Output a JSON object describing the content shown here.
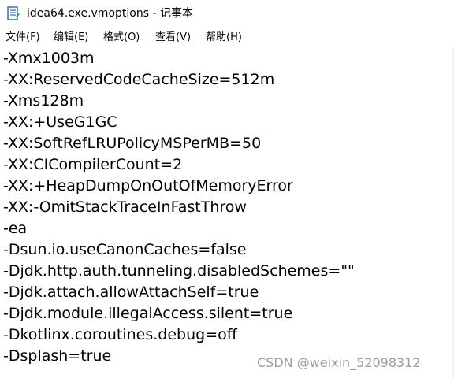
{
  "window": {
    "title": "idea64.exe.vmoptions - 记事本",
    "icon": "notepad-icon"
  },
  "menu": [
    {
      "label": "文件(F)"
    },
    {
      "label": "编辑(E)"
    },
    {
      "label": "格式(O)"
    },
    {
      "label": "查看(V)"
    },
    {
      "label": "帮助(H)"
    }
  ],
  "editor": {
    "lines": [
      "-Xmx1003m",
      "-XX:ReservedCodeCacheSize=512m",
      "-Xms128m",
      "-XX:+UseG1GC",
      "-XX:SoftRefLRUPolicyMSPerMB=50",
      "-XX:CICompilerCount=2",
      "-XX:+HeapDumpOnOutOfMemoryError",
      "-XX:-OmitStackTraceInFastThrow",
      "-ea",
      "-Dsun.io.useCanonCaches=false",
      "-Djdk.http.auth.tunneling.disabledSchemes=\"\"",
      "-Djdk.attach.allowAttachSelf=true",
      "-Djdk.module.illegalAccess.silent=true",
      "-Dkotlinx.coroutines.debug=off",
      "-Dsplash=true"
    ]
  },
  "watermark": {
    "text": "CSDN @weixin_52098312"
  },
  "colors": {
    "background": "#ffffff",
    "text": "#000000",
    "watermark": "#9e9e9e",
    "icon_blue": "#2f6fbf"
  }
}
